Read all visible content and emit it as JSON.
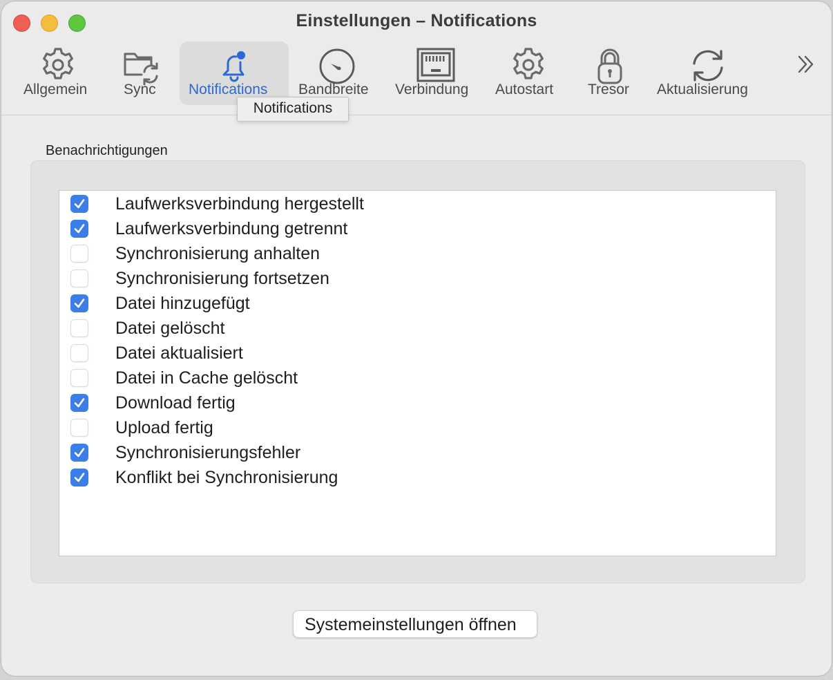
{
  "window": {
    "title": "Einstellungen – Notifications"
  },
  "toolbar": {
    "tabs": [
      {
        "label": "Allgemein",
        "icon": "gear-icon"
      },
      {
        "label": "Sync",
        "icon": "folder-sync-icon"
      },
      {
        "label": "Notifications",
        "icon": "bell-badge-icon",
        "active": true
      },
      {
        "label": "Bandbreite",
        "icon": "gauge-icon"
      },
      {
        "label": "Verbindung",
        "icon": "ethernet-port-icon"
      },
      {
        "label": "Autostart",
        "icon": "gear-icon"
      },
      {
        "label": "Tresor",
        "icon": "padlock-icon"
      },
      {
        "label": "Aktualisierung",
        "icon": "refresh-icon"
      }
    ],
    "overflow_icon": "double-chevron-right-icon",
    "tooltip": "Notifications"
  },
  "notifications": {
    "group_title": "Benachrichtigungen",
    "items": [
      {
        "label": "Laufwerksverbindung hergestellt",
        "checked": true
      },
      {
        "label": "Laufwerksverbindung getrennt",
        "checked": true
      },
      {
        "label": "Synchronisierung anhalten",
        "checked": false
      },
      {
        "label": "Synchronisierung fortsetzen",
        "checked": false
      },
      {
        "label": "Datei hinzugefügt",
        "checked": true
      },
      {
        "label": "Datei gelöscht",
        "checked": false
      },
      {
        "label": "Datei aktualisiert",
        "checked": false
      },
      {
        "label": "Datei in Cache gelöscht",
        "checked": false
      },
      {
        "label": "Download fertig",
        "checked": true
      },
      {
        "label": "Upload fertig",
        "checked": false
      },
      {
        "label": "Synchronisierungsfehler",
        "checked": true
      },
      {
        "label": "Konflikt bei Synchronisierung",
        "checked": true
      }
    ]
  },
  "footer": {
    "button_label": "Systemeinstellungen öffnen"
  },
  "colors": {
    "accent": "#3b7ee7",
    "active_tab_text": "#2b69d6",
    "close": "#ee5f57",
    "minimize": "#f5bd3c",
    "maximize": "#5fc73f"
  }
}
